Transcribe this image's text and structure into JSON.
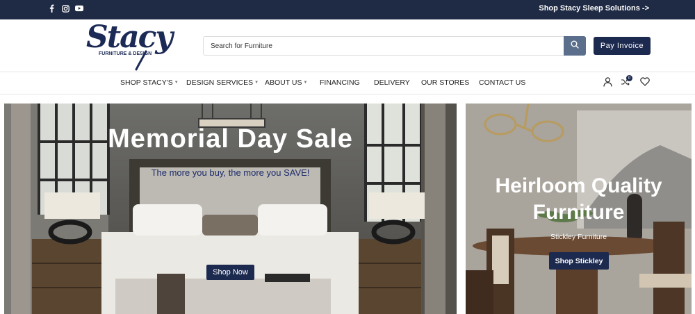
{
  "topbar": {
    "social": [
      "facebook-icon",
      "instagram-icon",
      "youtube-icon"
    ],
    "promo_link": "Shop Stacy Sleep Solutions ->"
  },
  "header": {
    "logo_script": "Stacy",
    "logo_sub": "FURNITURE & DESIGN",
    "search_placeholder": "Search for Furniture",
    "pay_button": "Pay Invoice"
  },
  "nav": {
    "items": [
      {
        "label": "SHOP STACY'S",
        "dropdown": true
      },
      {
        "label": "DESIGN SERVICES",
        "dropdown": true
      },
      {
        "label": "ABOUT US",
        "dropdown": true
      },
      {
        "label": "FINANCING",
        "dropdown": false
      },
      {
        "label": "DELIVERY",
        "dropdown": false
      },
      {
        "label": "OUR STORES",
        "dropdown": false
      },
      {
        "label": "CONTACT US",
        "dropdown": false
      }
    ],
    "compare_count": "0"
  },
  "hero_left": {
    "title": "Memorial Day Sale",
    "subtitle": "The more you buy, the more you SAVE!",
    "button": "Shop Now"
  },
  "hero_right": {
    "title": "Heirloom Quality Furniture",
    "subtitle": "Stickley Furniture",
    "button": "Shop Stickley"
  },
  "colors": {
    "navy": "#1c2a4f",
    "topbar": "#1f2b44",
    "search_button": "#5b6f8c",
    "subtitle_blue": "#1c2a6a"
  }
}
